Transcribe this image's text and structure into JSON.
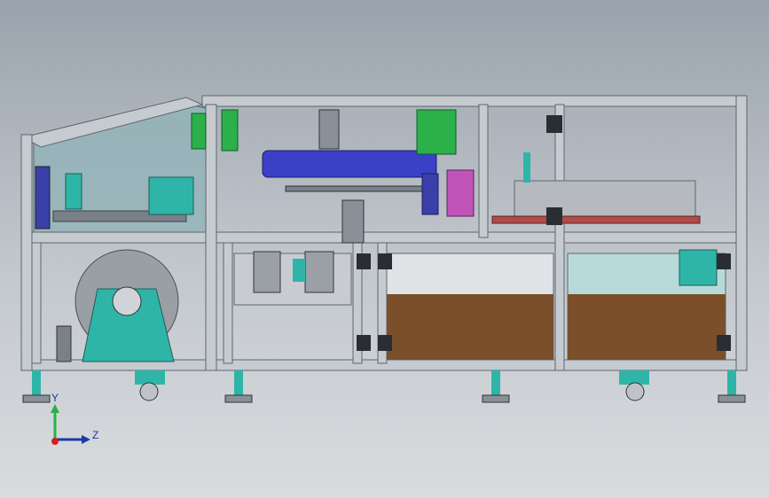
{
  "view": {
    "orientation_triad": {
      "y_label": "Y",
      "z_label": "Z"
    }
  },
  "colors": {
    "background_top": "#9aa3ad",
    "background_bottom": "#d9dcdf",
    "frame": "#b9bec4",
    "frame_edge": "#5e6670",
    "glass": "#8fb3b8",
    "teal_parts": "#2fb5a8",
    "green_brackets": "#2bb04a",
    "blue_cylinder": "#3a40c8",
    "brown_tank": "#7a4f2a",
    "dark_bracket": "#2a2d33"
  }
}
